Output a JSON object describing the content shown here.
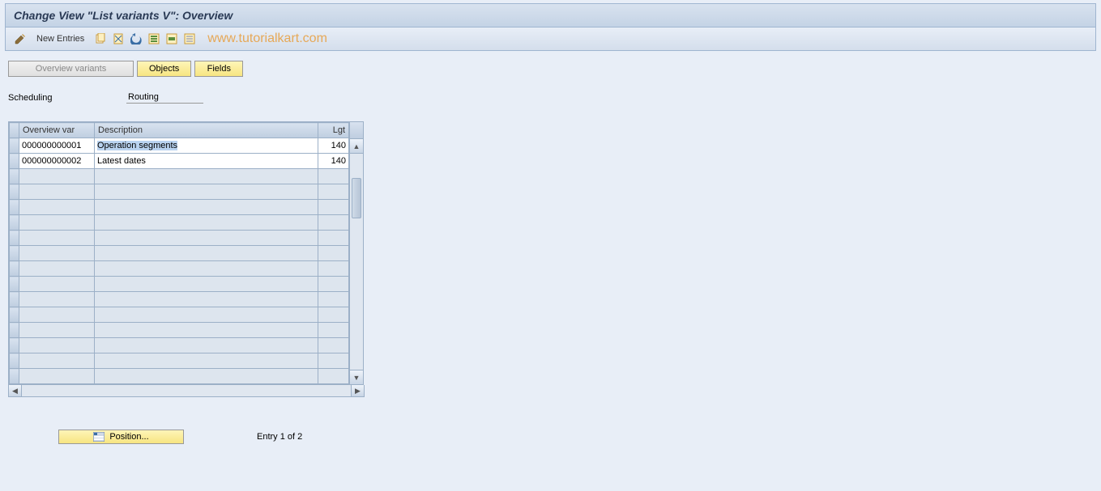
{
  "title": "Change View \"List variants                  V\": Overview",
  "toolbar": {
    "new_entries": "New Entries"
  },
  "watermark": "www.tutorialkart.com",
  "tabs": {
    "overview_variants": "Overview variants",
    "objects": "Objects",
    "fields": "Fields"
  },
  "info": {
    "scheduling_label": "Scheduling",
    "scheduling_value": "Routing"
  },
  "table": {
    "headers": {
      "var": "Overview var",
      "desc": "Description",
      "lgt": "Lgt"
    },
    "rows": [
      {
        "var": "000000000001",
        "desc": "Operation segments",
        "lgt": "140",
        "selected": true
      },
      {
        "var": "000000000002",
        "desc": "Latest dates",
        "lgt": "140",
        "selected": false
      }
    ],
    "empty_rows": 14
  },
  "footer": {
    "position": "Position...",
    "entry": "Entry 1 of 2"
  }
}
